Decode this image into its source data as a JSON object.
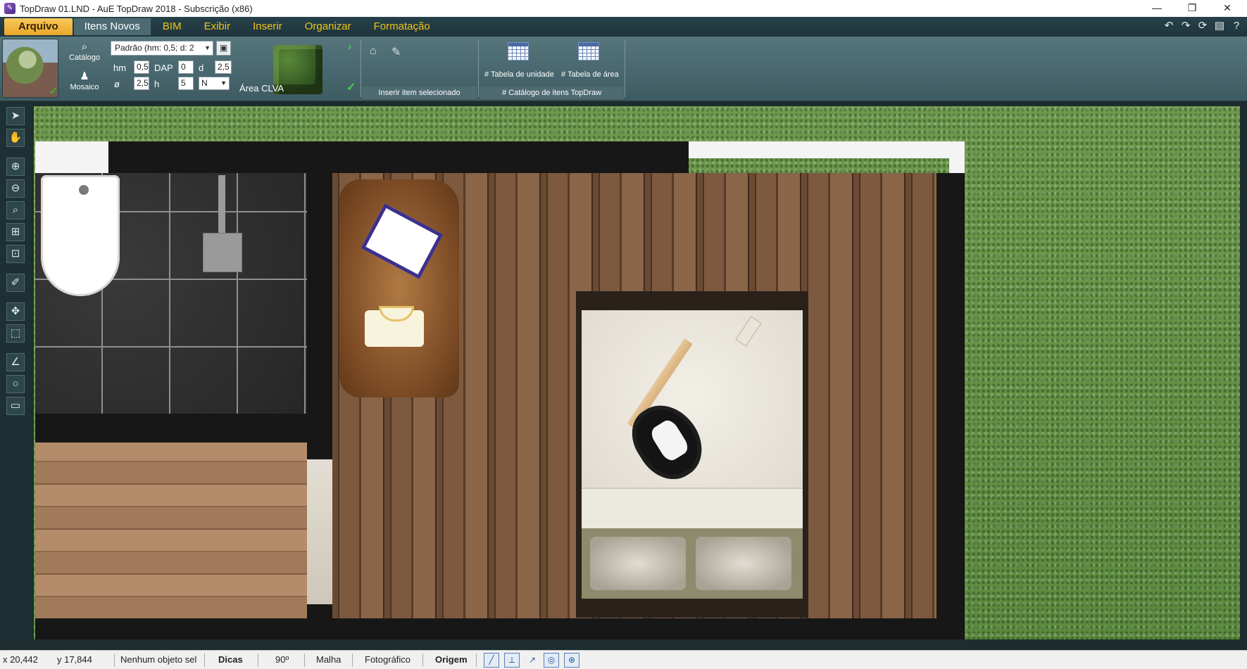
{
  "window": {
    "title": "TopDraw 01.LND - AuE TopDraw 2018 - Subscrição (x86)",
    "minimize": "—",
    "restore": "❐",
    "close": "✕"
  },
  "menu": {
    "items": [
      "Arquivo",
      "Itens Novos",
      "BIM",
      "Exibir",
      "Inserir",
      "Organizar",
      "Formatação"
    ],
    "active_index": 0,
    "selected_index": 1
  },
  "quick_access": [
    "undo-icon",
    "redo-icon",
    "refresh-icon",
    "save-icon",
    "help-icon"
  ],
  "ribbon": {
    "catalog_label": "Catálogo",
    "mosaic_label": "Mosaico",
    "preset": "Padrão (hm: 0,5; d: 2",
    "fields": {
      "hm_label": "hm",
      "hm_value": "0,5",
      "dap_label": "DAP",
      "dap_value": "0",
      "d_label": "d",
      "d_value": "2,5",
      "diameter_label": "ø",
      "diameter_value": "2,5",
      "h_label": "h",
      "h_value": "5",
      "n_select": "N"
    },
    "area_label": "Área CLVA",
    "insert_group_label": "Inserir item selecionado",
    "unit_table_label": "# Tabela de unidade",
    "area_table_label": "# Tabela de área",
    "catalog_group_label": "# Catálogo de itens TopDraw"
  },
  "left_tools": [
    "select-arrow-icon",
    "pan-hand-icon",
    "zoom-in-icon",
    "zoom-out-icon",
    "zoom-window-icon",
    "zoom-extents-icon",
    "zoom-previous-icon",
    "measure-icon",
    "move-icon",
    "marquee-select-icon",
    "polyline-icon",
    "circle-icon",
    "rectangle-icon"
  ],
  "status": {
    "x": "x 20,442",
    "y": "y 17,844",
    "selection": "Nenhum objeto sel",
    "tips": "Dicas",
    "angle": "90º",
    "grid": "Malha",
    "render_mode": "Fotográfico",
    "origin": "Origem"
  },
  "colors": {
    "menu_text": "#f0c419",
    "menu_active": "#f3b947",
    "ribbon": "#4d6a71",
    "grass": "#6a954a",
    "wall": "#171717"
  }
}
